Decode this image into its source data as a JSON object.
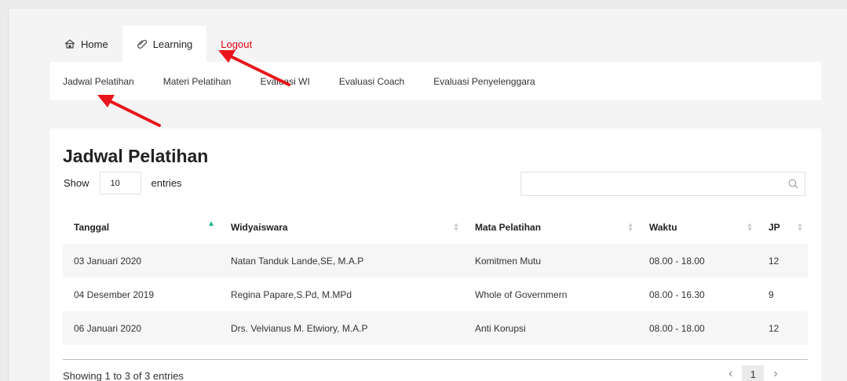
{
  "topnav": {
    "home_label": "Home",
    "learning_label": "Learning",
    "logout_label": "Logout"
  },
  "subnav": {
    "items": [
      "Jadwal Pelatihan",
      "Materi Pelatihan",
      "Evaluasi WI",
      "Evaluasi Coach",
      "Evaluasi Penyelenggara"
    ]
  },
  "main": {
    "title": "Jadwal Pelatihan",
    "show_label": "Show",
    "entries_value": "10",
    "entries_label": "entries",
    "search_placeholder": ""
  },
  "table": {
    "headers": [
      "Tanggal",
      "Widyaiswara",
      "Mata Pelatihan",
      "Waktu",
      "JP"
    ],
    "rows": [
      [
        "03 Januari 2020",
        "Natan Tanduk Lande,SE, M.A.P",
        "Komitmen Mutu",
        "08.00 - 18.00",
        "12"
      ],
      [
        "04 Desember 2019",
        "Regina Papare,S.Pd, M.MPd",
        "Whole of Governmern",
        "08.00 - 16.30",
        "9"
      ],
      [
        "06 Januari 2020",
        "Drs. Velvianus M. Etwiory, M.A.P",
        "Anti Korupsi",
        "08.00 - 18.00",
        "12"
      ]
    ]
  },
  "footer": {
    "info": "Showing 1 to 3 of 3 entries",
    "current_page": "1",
    "prev_icon": "‹",
    "next_icon": "›"
  },
  "colors": {
    "accent_sort": "#1bb38e",
    "logout": "#e8000e",
    "annotation_arrow": "#e8161b"
  },
  "icons": [
    "home-icon",
    "paperclip-icon",
    "search-icon",
    "sort-asc-icon",
    "sort-both-icon",
    "chevron-left-icon",
    "chevron-right-icon"
  ]
}
